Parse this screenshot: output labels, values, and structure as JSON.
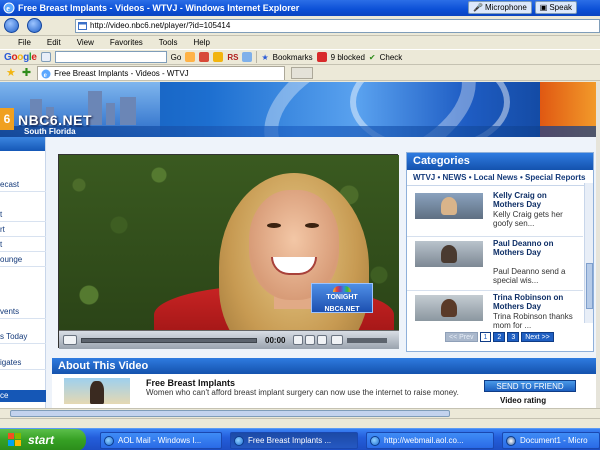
{
  "window": {
    "title": "Free Breast Implants - Videos - WTVJ - Windows Internet Explorer",
    "langbar": [
      "Microphone",
      "Speak"
    ]
  },
  "address": {
    "url": "http://video.nbc6.net/player/?id=105414"
  },
  "menu": [
    "File",
    "Edit",
    "View",
    "Favorites",
    "Tools",
    "Help"
  ],
  "google_toolbar": {
    "brand": "Google",
    "go": "Go",
    "rs": "RS",
    "bookmarks": "Bookmarks",
    "blocked": "9 blocked",
    "check": "Check",
    "accent": "#2a5ad8"
  },
  "tab": {
    "label": "Free Breast Implants - Videos - WTVJ"
  },
  "site": {
    "logo": "NBC6.NET",
    "region": "South Florida",
    "leftnav": [
      "ecast",
      "t",
      "rt",
      "t",
      "ounge",
      "vents",
      "s Today",
      "igates"
    ],
    "leftnav_footer": "ce"
  },
  "player": {
    "time": "00:00",
    "overlay_line1": "TONIGHT",
    "overlay_line2": "NBC6.NET"
  },
  "categories": {
    "title": "Categories",
    "breadcrumb": "WTVJ • NEWS • Local News • Special Reports",
    "items": [
      {
        "title": "Kelly Craig on Mothers Day",
        "desc": "Kelly Craig gets her goofy sen..."
      },
      {
        "title": "Paul Deanno on Mothers Day",
        "desc": "Paul Deanno send a special wis..."
      },
      {
        "title": "Trina Robinson on Mothers Day",
        "desc": "Trina Robinson thanks mom for ..."
      }
    ],
    "pager": {
      "prev": "<< Prev",
      "pages": [
        "1",
        "2",
        "3"
      ],
      "current": "1",
      "next": "Next >>"
    }
  },
  "about": {
    "heading": "About This Video",
    "video_title": "Free Breast Implants",
    "desc": "Women who can't afford breast implant surgery can now use the internet to raise money.",
    "send_button": "SEND TO FRIEND",
    "rating_label": "Video rating"
  },
  "taskbar": {
    "start": "start",
    "buttons": [
      "AOL Mail - Windows I...",
      "Free Breast Implants ...",
      "http://webmail.aol.co...",
      "Document1 - Micro"
    ]
  }
}
